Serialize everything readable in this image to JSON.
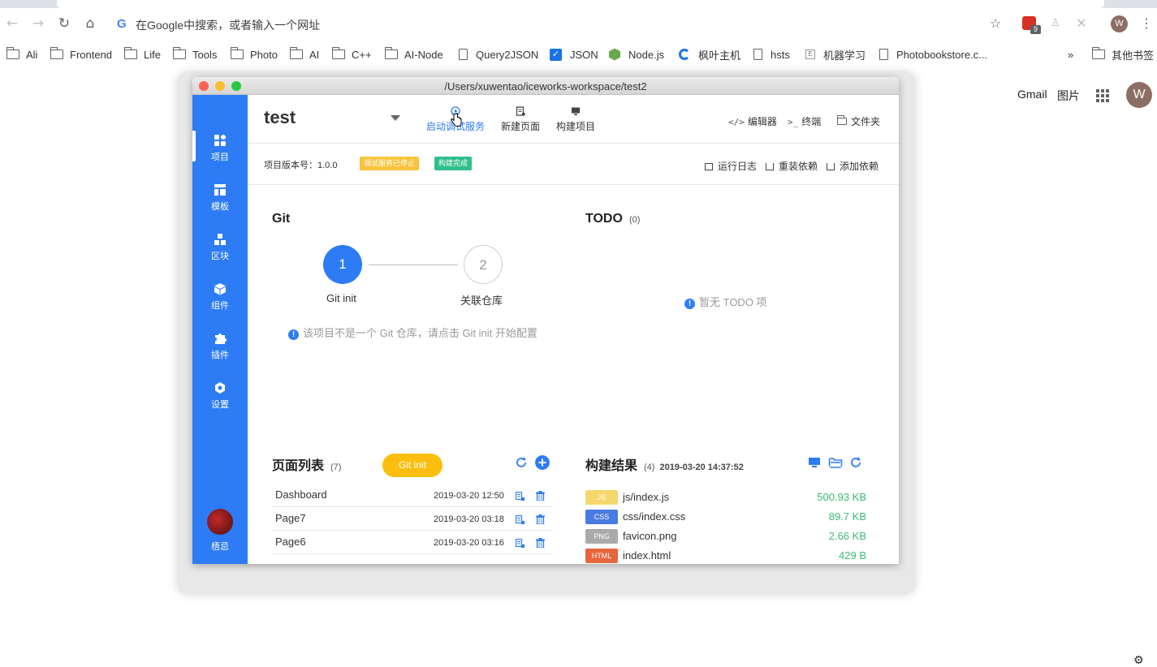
{
  "browser": {
    "omnibox_placeholder": "在Google中搜索，或者输入一个网址",
    "extension_badge": "9",
    "profile_initial": "W",
    "bookmarks": [
      {
        "label": "Ali",
        "icon": "folder-icon"
      },
      {
        "label": "Frontend",
        "icon": "folder-icon"
      },
      {
        "label": "Life",
        "icon": "folder-icon"
      },
      {
        "label": "Tools",
        "icon": "folder-icon"
      },
      {
        "label": "Photo",
        "icon": "folder-icon"
      },
      {
        "label": "AI",
        "icon": "folder-icon"
      },
      {
        "label": "C++",
        "icon": "folder-icon"
      },
      {
        "label": "AI-Node",
        "icon": "folder-icon"
      },
      {
        "label": "Query2JSON",
        "icon": "page-icon"
      },
      {
        "label": "JSON",
        "icon": "checkbox-icon"
      },
      {
        "label": "Node.js",
        "icon": "nodejs-icon"
      },
      {
        "label": "枫叶主机",
        "icon": "maple-icon"
      },
      {
        "label": "hsts",
        "icon": "page-icon"
      },
      {
        "label": "机器学习",
        "icon": "page-icon"
      },
      {
        "label": "Photobookstore.c...",
        "icon": "page-icon"
      }
    ],
    "bookmarks_overflow": "»",
    "other_bookmarks": "其他书签",
    "gmail_link": "Gmail",
    "images_link": "图片",
    "account_initial": "W"
  },
  "window": {
    "title": "/Users/xuwentao/iceworks-workspace/test2"
  },
  "sidebar": {
    "items": [
      {
        "label": "项目",
        "icon": "dashboard-icon"
      },
      {
        "label": "模板",
        "icon": "layout-icon"
      },
      {
        "label": "区块",
        "icon": "blocks-icon"
      },
      {
        "label": "组件",
        "icon": "cube-icon"
      },
      {
        "label": "插件",
        "icon": "puzzle-icon"
      },
      {
        "label": "设置",
        "icon": "gear-icon"
      }
    ],
    "user_name": "梧忌"
  },
  "header": {
    "project_name": "test",
    "actions": [
      {
        "label": "启动调试服务",
        "icon": "play-icon"
      },
      {
        "label": "新建页面",
        "icon": "new-page-icon"
      },
      {
        "label": "构建项目",
        "icon": "build-icon"
      }
    ],
    "right_actions": [
      {
        "label": "编辑器",
        "icon": "code-icon",
        "glyph": "</>"
      },
      {
        "label": "终端",
        "icon": "terminal-icon",
        "glyph": ">_"
      },
      {
        "label": "文件夹",
        "icon": "folder-icon",
        "glyph": ""
      }
    ]
  },
  "info": {
    "version_label": "项目版本号：1.0.0",
    "tags": [
      {
        "label": "调试服务已停止",
        "color": "#f8c33d"
      },
      {
        "label": "构建完成",
        "color": "#2fbf8a"
      }
    ],
    "actions": [
      {
        "label": "运行日志"
      },
      {
        "label": "重装依赖"
      },
      {
        "label": "添加依赖"
      }
    ]
  },
  "git": {
    "title": "Git",
    "steps": [
      {
        "number": "1",
        "label": "Git init"
      },
      {
        "number": "2",
        "label": "关联仓库"
      }
    ],
    "hint": "该项目不是一个 Git 仓库，请点击 Git init 开始配置",
    "button": "Git init"
  },
  "todo": {
    "title": "TODO",
    "count": "(0)",
    "empty": "暂无 TODO 项"
  },
  "pages": {
    "title": "页面列表",
    "count": "(7)",
    "rows": [
      {
        "name": "Dashboard",
        "date": "2019-03-20 12:50"
      },
      {
        "name": "Page7",
        "date": "2019-03-20 03:18"
      },
      {
        "name": "Page6",
        "date": "2019-03-20 03:16"
      }
    ]
  },
  "build": {
    "title": "构建结果",
    "count": "(4)",
    "time": "2019-03-20 14:37:52",
    "files": [
      {
        "type": "JS",
        "name": "js/index.js",
        "size": "500.93 KB",
        "color": "#f5d76e"
      },
      {
        "type": "CSS",
        "name": "css/index.css",
        "size": "89.7 KB",
        "color": "#4a7be3"
      },
      {
        "type": "PNG",
        "name": "favicon.png",
        "size": "2.66 KB",
        "color": "#aaaaaa"
      },
      {
        "type": "HTML",
        "name": "index.html",
        "size": "429 B",
        "color": "#e8663d"
      }
    ]
  },
  "colors": {
    "primary": "#2d7cf6",
    "warning": "#fcbe0e",
    "success": "#3dba6f"
  }
}
